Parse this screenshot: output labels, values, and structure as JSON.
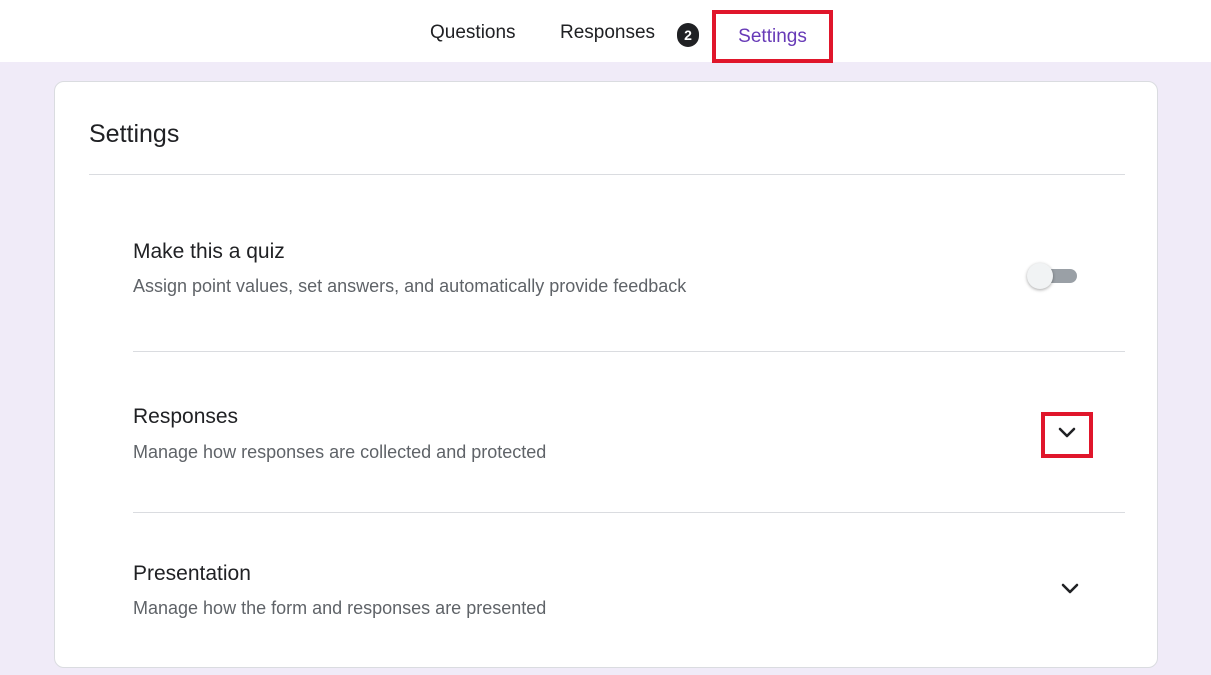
{
  "tabs": {
    "questions": "Questions",
    "responses": "Responses",
    "responses_badge": "2",
    "settings": "Settings"
  },
  "card": {
    "title": "Settings",
    "rows": [
      {
        "title": "Make this a quiz",
        "description": "Assign point values, set answers, and automatically provide feedback",
        "control": "toggle",
        "toggle_on": false
      },
      {
        "title": "Responses",
        "description": "Manage how responses are collected and protected",
        "control": "chevron-down-icon"
      },
      {
        "title": "Presentation",
        "description": "Manage how the form and responses are presented",
        "control": "chevron-down-icon"
      }
    ]
  },
  "colors": {
    "background": "#f0ebf8",
    "accent": "#673ab7",
    "highlight_border": "#e0162b"
  }
}
